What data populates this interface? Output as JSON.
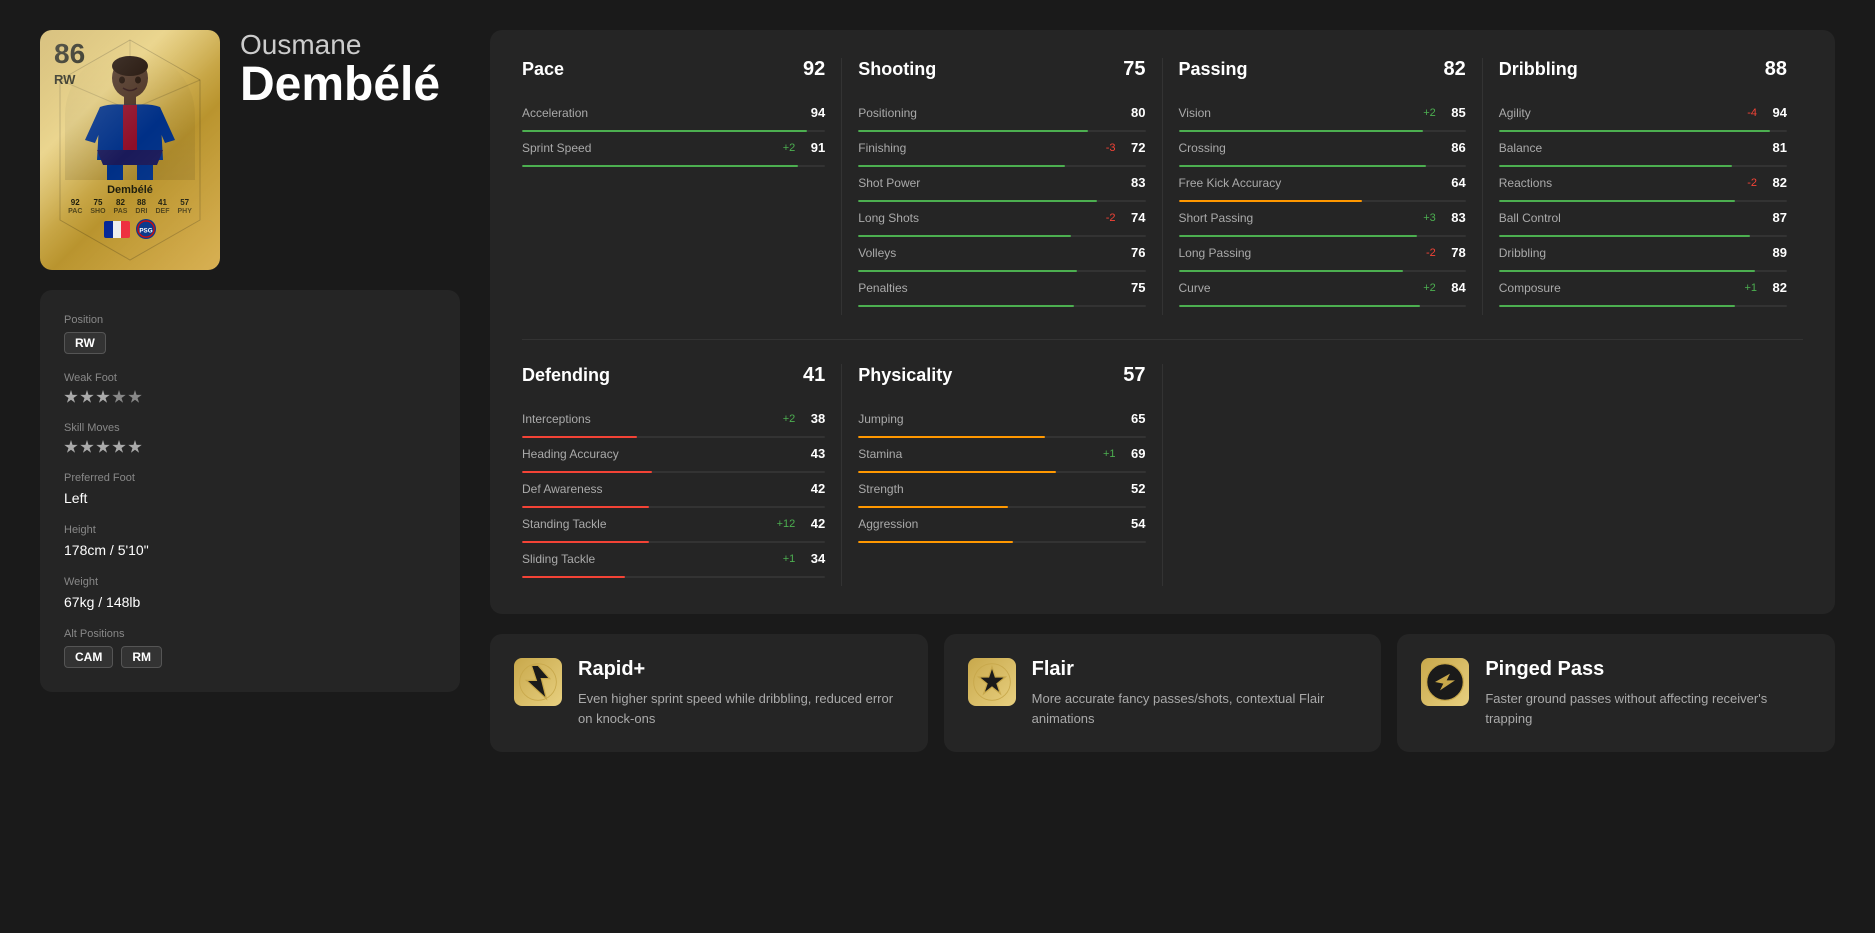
{
  "player": {
    "first_name": "Ousmane",
    "last_name": "Dembélé",
    "rating": "86",
    "position": "RW",
    "card_name": "Dembélé",
    "card_stats": [
      {
        "label": "PAC",
        "value": "92"
      },
      {
        "label": "SHO",
        "value": "75"
      },
      {
        "label": "PAS",
        "value": "82"
      },
      {
        "label": "DRI",
        "value": "88"
      },
      {
        "label": "DEF",
        "value": "41"
      },
      {
        "label": "PHY",
        "value": "57"
      }
    ]
  },
  "info": {
    "position_label": "Position",
    "position_value": "RW",
    "weak_foot_label": "Weak Foot",
    "weak_foot_stars": 3,
    "skill_moves_label": "Skill Moves",
    "skill_moves_stars": 5,
    "preferred_foot_label": "Preferred Foot",
    "preferred_foot_value": "Left",
    "height_label": "Height",
    "height_value": "178cm / 5'10\"",
    "weight_label": "Weight",
    "weight_value": "67kg / 148lb",
    "alt_positions_label": "Alt Positions",
    "alt_positions": [
      "CAM",
      "RM"
    ]
  },
  "stats": {
    "pace": {
      "name": "Pace",
      "value": 92,
      "attributes": [
        {
          "name": "Acceleration",
          "value": 94,
          "modifier": "",
          "bar_pct": 94
        },
        {
          "name": "Sprint Speed",
          "value": 91,
          "modifier": "+2",
          "bar_pct": 91
        }
      ]
    },
    "shooting": {
      "name": "Shooting",
      "value": 75,
      "attributes": [
        {
          "name": "Positioning",
          "value": 80,
          "modifier": "",
          "bar_pct": 80
        },
        {
          "name": "Finishing",
          "value": 72,
          "modifier": "-3",
          "bar_pct": 72
        },
        {
          "name": "Shot Power",
          "value": 83,
          "modifier": "",
          "bar_pct": 83
        },
        {
          "name": "Long Shots",
          "value": 74,
          "modifier": "-2",
          "bar_pct": 74
        },
        {
          "name": "Volleys",
          "value": 76,
          "modifier": "",
          "bar_pct": 76
        },
        {
          "name": "Penalties",
          "value": 75,
          "modifier": "",
          "bar_pct": 75
        }
      ]
    },
    "passing": {
      "name": "Passing",
      "value": 82,
      "attributes": [
        {
          "name": "Vision",
          "value": 85,
          "modifier": "+2",
          "bar_pct": 85
        },
        {
          "name": "Crossing",
          "value": 86,
          "modifier": "",
          "bar_pct": 86
        },
        {
          "name": "Free Kick Accuracy",
          "value": 64,
          "modifier": "",
          "bar_pct": 64
        },
        {
          "name": "Short Passing",
          "value": 83,
          "modifier": "+3",
          "bar_pct": 83
        },
        {
          "name": "Long Passing",
          "value": 78,
          "modifier": "-2",
          "bar_pct": 78
        },
        {
          "name": "Curve",
          "value": 84,
          "modifier": "+2",
          "bar_pct": 84
        }
      ]
    },
    "dribbling": {
      "name": "Dribbling",
      "value": 88,
      "attributes": [
        {
          "name": "Agility",
          "value": 94,
          "modifier": "-4",
          "bar_pct": 94
        },
        {
          "name": "Balance",
          "value": 81,
          "modifier": "",
          "bar_pct": 81
        },
        {
          "name": "Reactions",
          "value": 82,
          "modifier": "-2",
          "bar_pct": 82
        },
        {
          "name": "Ball Control",
          "value": 87,
          "modifier": "",
          "bar_pct": 87
        },
        {
          "name": "Dribbling",
          "value": 89,
          "modifier": "",
          "bar_pct": 89
        },
        {
          "name": "Composure",
          "value": 82,
          "modifier": "+1",
          "bar_pct": 82
        }
      ]
    },
    "defending": {
      "name": "Defending",
      "value": 41,
      "attributes": [
        {
          "name": "Interceptions",
          "value": 38,
          "modifier": "+2",
          "bar_pct": 38
        },
        {
          "name": "Heading Accuracy",
          "value": 43,
          "modifier": "",
          "bar_pct": 43
        },
        {
          "name": "Def Awareness",
          "value": 42,
          "modifier": "",
          "bar_pct": 42
        },
        {
          "name": "Standing Tackle",
          "value": 42,
          "modifier": "+12",
          "bar_pct": 42
        },
        {
          "name": "Sliding Tackle",
          "value": 34,
          "modifier": "+1",
          "bar_pct": 34
        }
      ]
    },
    "physicality": {
      "name": "Physicality",
      "value": 57,
      "attributes": [
        {
          "name": "Jumping",
          "value": 65,
          "modifier": "",
          "bar_pct": 65
        },
        {
          "name": "Stamina",
          "value": 69,
          "modifier": "+1",
          "bar_pct": 69
        },
        {
          "name": "Strength",
          "value": 52,
          "modifier": "",
          "bar_pct": 52
        },
        {
          "name": "Aggression",
          "value": 54,
          "modifier": "",
          "bar_pct": 54
        }
      ]
    }
  },
  "playstyles": [
    {
      "name": "Rapid+",
      "icon": "⚡",
      "description": "Even higher sprint speed while dribbling, reduced error on knock-ons",
      "icon_color": "#c8a84b"
    },
    {
      "name": "Flair",
      "icon": "✦",
      "description": "More accurate fancy passes/shots, contextual Flair animations",
      "icon_color": "#c8a84b"
    },
    {
      "name": "Pinged Pass",
      "icon": "→",
      "description": "Faster ground passes without affecting receiver's trapping",
      "icon_color": "#c8a84b"
    }
  ],
  "colors": {
    "bar_high": "#4caf50",
    "bar_medium": "#ff9800",
    "bar_low": "#f44336",
    "modifier_positive": "#4caf50",
    "modifier_negative": "#f44336",
    "background": "#1a1a1a",
    "panel_bg": "#252525"
  }
}
